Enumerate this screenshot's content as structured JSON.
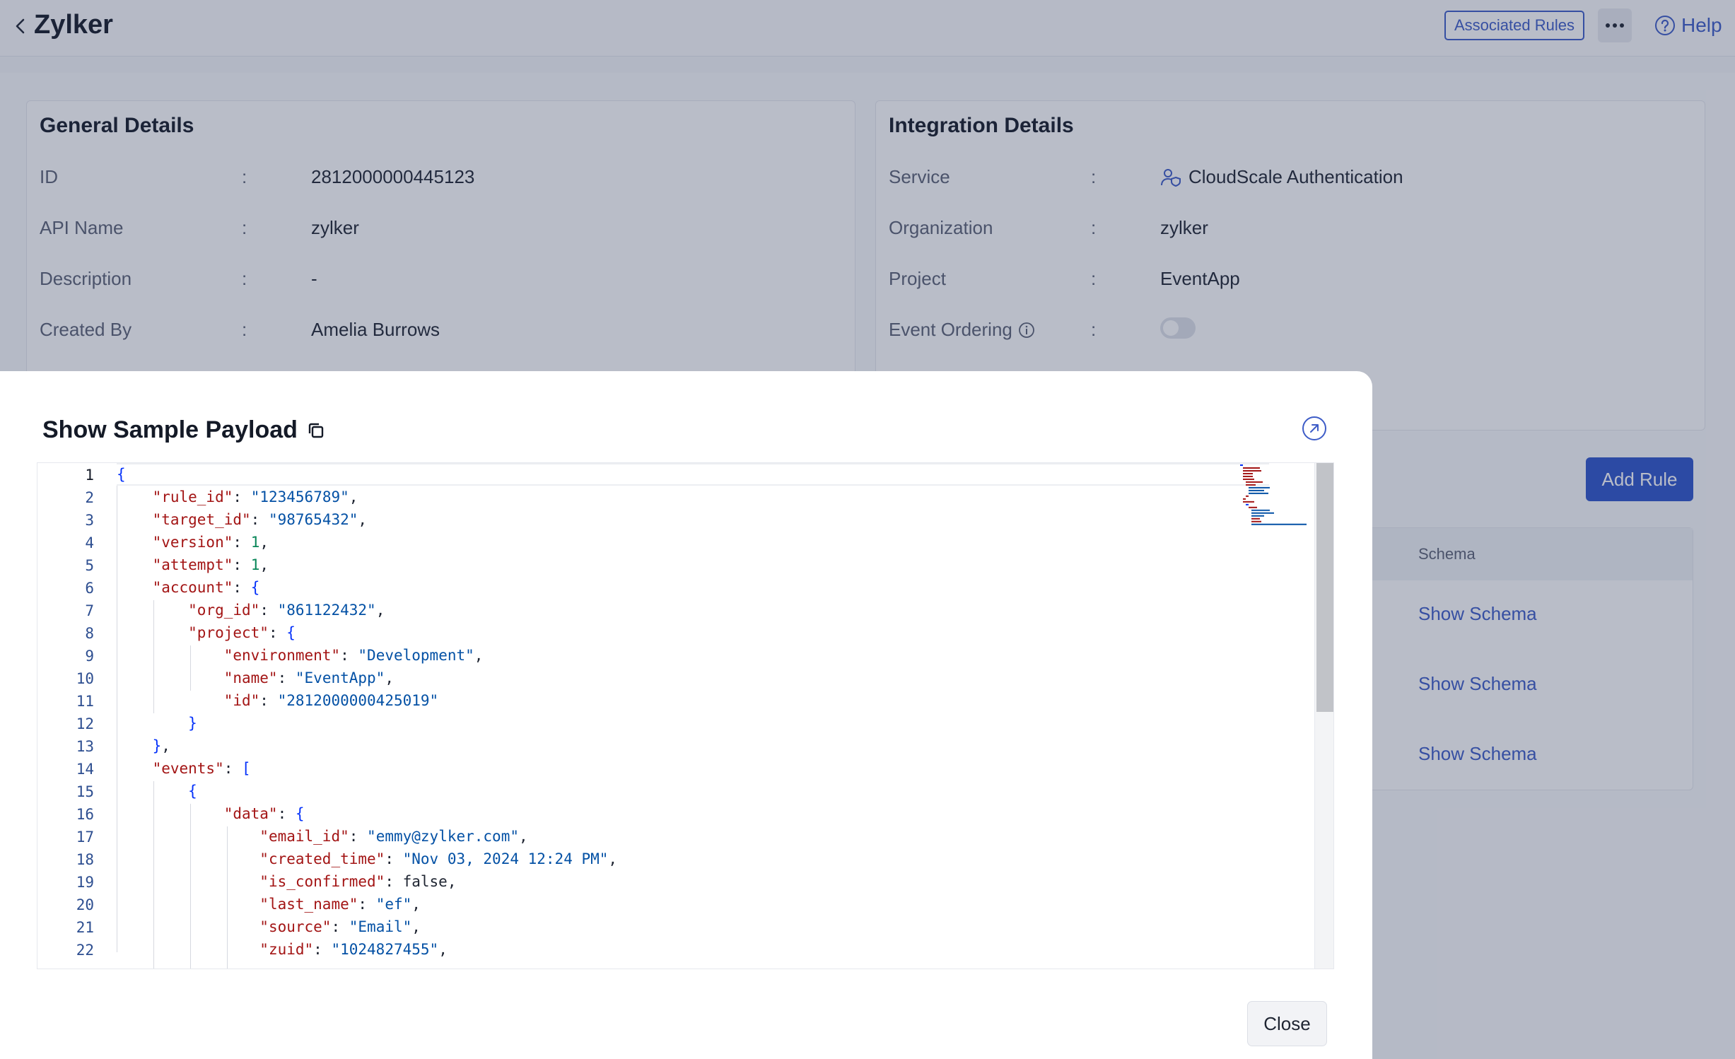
{
  "header": {
    "title": "Zylker",
    "associated_rules_label": "Associated Rules",
    "help_label": "Help"
  },
  "general_details": {
    "title": "General Details",
    "rows": [
      {
        "label": "ID",
        "value": "2812000000445123"
      },
      {
        "label": "API Name",
        "value": "zylker"
      },
      {
        "label": "Description",
        "value": "-"
      },
      {
        "label": "Created By",
        "value": "Amelia Burrows"
      }
    ],
    "separator": ":"
  },
  "integration_details": {
    "title": "Integration Details",
    "rows": [
      {
        "label": "Service",
        "value": "CloudScale Authentication",
        "icon": "user-shield-icon"
      },
      {
        "label": "Organization",
        "value": "zylker"
      },
      {
        "label": "Project",
        "value": "EventApp"
      },
      {
        "label": "Event Ordering",
        "value": "",
        "toggle": false,
        "info_icon": "info-icon"
      }
    ]
  },
  "rules": {
    "add_rule_label": "Add Rule",
    "column_schema": "Schema",
    "show_schema_links": [
      "Show Schema",
      "Show Schema",
      "Show Schema"
    ]
  },
  "modal": {
    "title": "Show Sample Payload",
    "close_label": "Close",
    "active_line": 1,
    "line_numbers": [
      "1",
      "2",
      "3",
      "4",
      "5",
      "6",
      "7",
      "8",
      "9",
      "10",
      "11",
      "12",
      "13",
      "14",
      "15",
      "16",
      "17",
      "18",
      "19",
      "20",
      "21",
      "22"
    ],
    "lines": [
      "{",
      "    \"rule_id\": \"123456789\",",
      "    \"target_id\": \"98765432\",",
      "    \"version\": 1,",
      "    \"attempt\": 1,",
      "    \"account\": {",
      "        \"org_id\": \"861122432\",",
      "        \"project\": {",
      "            \"environment\": \"Development\",",
      "            \"name\": \"EventApp\",",
      "            \"id\": \"2812000000425019\"",
      "        }",
      "    },",
      "    \"events\": [",
      "        {",
      "            \"data\": {",
      "                \"email_id\": \"emmy@zylker.com\",",
      "                \"created_time\": \"Nov 03, 2024 12:24 PM\",",
      "                \"is_confirmed\": false,",
      "                \"last_name\": \"ef\",",
      "                \"source\": \"Email\",",
      "                \"zuid\": \"1024827455\","
    ]
  },
  "colors": {
    "accent": "#3d5cc7",
    "json_key": "#a31515",
    "json_string": "#0451a5",
    "json_number": "#098658",
    "json_bracket": "#0431fa"
  }
}
